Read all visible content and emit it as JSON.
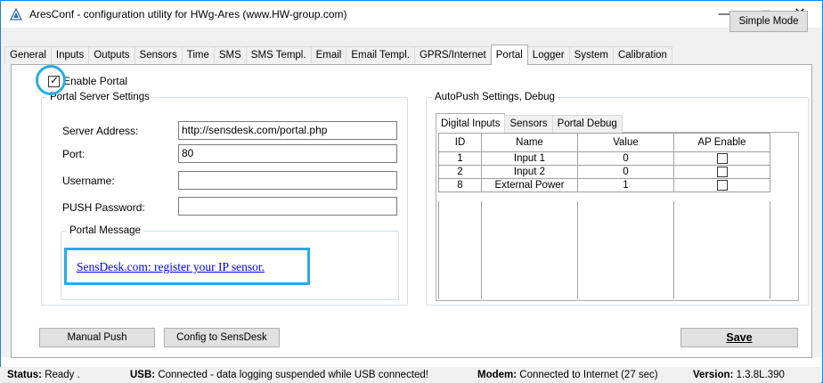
{
  "window": {
    "title": "AresConf - configuration utility for HWg-Ares (www.HW-group.com)",
    "minimize_glyph": "—",
    "maximize_glyph": "☐",
    "close_glyph": "✕"
  },
  "tabs": [
    {
      "label": "General"
    },
    {
      "label": "Inputs"
    },
    {
      "label": "Outputs"
    },
    {
      "label": "Sensors"
    },
    {
      "label": "Time"
    },
    {
      "label": "SMS"
    },
    {
      "label": "SMS Templ."
    },
    {
      "label": "Email"
    },
    {
      "label": "Email Templ."
    },
    {
      "label": "GPRS/Internet"
    },
    {
      "label": "Portal"
    },
    {
      "label": "Logger"
    },
    {
      "label": "System"
    },
    {
      "label": "Calibration"
    }
  ],
  "active_tab": "Portal",
  "simple_mode_label": "Simple Mode",
  "portal": {
    "enable_label": "Enable Portal",
    "enabled": true,
    "server_group_title": "Portal Server Settings",
    "server_address_label": "Server Address:",
    "server_address_value": "http://sensdesk.com/portal.php",
    "port_label": "Port:",
    "port_value": "80",
    "username_label": "Username:",
    "username_value": "",
    "push_password_label": "PUSH Password:",
    "push_password_value": "",
    "message_group_title": "Portal Message",
    "message_link": "SensDesk.com: register your IP sensor."
  },
  "autopush": {
    "group_title": "AutoPush Settings, Debug",
    "subtabs": [
      {
        "label": "Digital Inputs"
      },
      {
        "label": "Sensors"
      },
      {
        "label": "Portal Debug"
      }
    ],
    "columns": [
      "ID",
      "Name",
      "Value",
      "AP Enable"
    ],
    "rows": [
      {
        "id": "1",
        "name": "Input 1",
        "value": "0",
        "ap_enable": false
      },
      {
        "id": "2",
        "name": "Input 2",
        "value": "0",
        "ap_enable": false
      },
      {
        "id": "8",
        "name": "External Power",
        "value": "1",
        "ap_enable": false
      }
    ]
  },
  "buttons": {
    "manual_push": "Manual Push",
    "config_to_sensdesk": "Config to SensDesk",
    "save": "Save"
  },
  "status": {
    "status_label": "Status:",
    "status_value": "Ready .",
    "usb_label": "USB:",
    "usb_value": "Connected - data logging suspended while USB connected!",
    "modem_label": "Modem:",
    "modem_value": "Connected to Internet (27 sec)",
    "version_label": "Version:",
    "version_value": "1.3.8L.390"
  },
  "colors": {
    "accent": "#29abe2",
    "link": "#0000ee",
    "window_border": "#1883d7"
  }
}
